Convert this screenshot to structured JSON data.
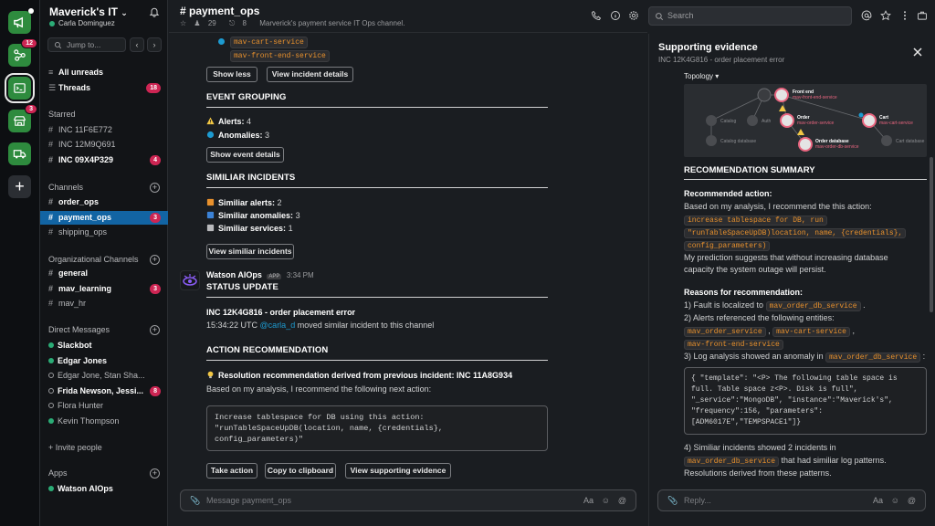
{
  "rail": {
    "apps": [
      {
        "name": "alerts-app",
        "badge": ""
      },
      {
        "name": "topology-app",
        "badge": "12"
      },
      {
        "name": "terminal-app",
        "badge": ""
      },
      {
        "name": "store-app",
        "badge": "3"
      },
      {
        "name": "delivery-app",
        "badge": ""
      }
    ],
    "add_label": "+"
  },
  "sidebar": {
    "workspace": "Maverick's IT",
    "user": "Carla Dominguez",
    "jump_placeholder": "Jump to...",
    "all_unreads": "All unreads",
    "threads": "Threads",
    "threads_badge": "18",
    "starred_label": "Starred",
    "starred": [
      {
        "label": "INC 11F6E772",
        "badge": "",
        "bold": false
      },
      {
        "label": "INC 12M9Q691",
        "badge": "",
        "bold": false
      },
      {
        "label": "INC 09X4P329",
        "badge": "4",
        "bold": true
      }
    ],
    "channels_label": "Channels",
    "channels": [
      {
        "label": "order_ops",
        "badge": "",
        "bold": true,
        "selected": false
      },
      {
        "label": "payment_ops",
        "badge": "3",
        "bold": true,
        "selected": true
      },
      {
        "label": "shipping_ops",
        "badge": "",
        "bold": false,
        "selected": false
      }
    ],
    "org_label": "Organizational Channels",
    "org_channels": [
      {
        "label": "general",
        "badge": "",
        "bold": true
      },
      {
        "label": "mav_learning",
        "badge": "3",
        "bold": true
      },
      {
        "label": "mav_hr",
        "badge": "",
        "bold": false
      }
    ],
    "dm_label": "Direct Messages",
    "dms": [
      {
        "label": "Slackbot",
        "online": true,
        "bold": true,
        "badge": ""
      },
      {
        "label": "Edgar Jones",
        "online": true,
        "bold": true,
        "badge": ""
      },
      {
        "label": "Edgar Jone, Stan Sha...",
        "online": false,
        "bold": false,
        "badge": ""
      },
      {
        "label": "Frida Newson, Jessi...",
        "online": false,
        "bold": true,
        "badge": "8"
      },
      {
        "label": "Flora Hunter",
        "online": false,
        "bold": false,
        "badge": ""
      },
      {
        "label": "Kevin Thompson",
        "online": true,
        "bold": false,
        "badge": ""
      }
    ],
    "invite": "+ Invite people",
    "apps_label": "Apps",
    "apps": [
      {
        "label": "Watson AIOps",
        "online": true
      }
    ]
  },
  "channel": {
    "title": "# payment_ops",
    "members": "29",
    "pins": "8",
    "topic": "Marverick's payment service IT Ops channel."
  },
  "search": {
    "placeholder": "Search"
  },
  "main": {
    "services": [
      "mav-cart-service",
      "mav-front-end-service"
    ],
    "show_less": "Show less",
    "view_incident": "View incident details",
    "event_grouping_title": "EVENT GROUPING",
    "alerts_label": "Alerts:",
    "alerts_count": "4",
    "anomalies_label": "Anomalies:",
    "anomalies_count": "3",
    "show_event": "Show event details",
    "similar_title": "SIMILIAR INCIDENTS",
    "similar_alerts_label": "Similiar alerts:",
    "similar_alerts_count": "2",
    "similar_anomalies_label": "Similiar anomalies:",
    "similar_anomalies_count": "3",
    "similar_services_label": "Similiar services:",
    "similar_services_count": "1",
    "view_similar": "View similiar incidents",
    "bot_name": "Watson AIOps",
    "bot_tag": "APP",
    "bot_time": "3:34 PM",
    "status_title": "STATUS UPDATE",
    "incident_line": "INC 12K4G816 - order placement error",
    "moved_time": "15:34:22 UTC",
    "moved_user": "@carla_d",
    "moved_text": "moved similar incident to this channel",
    "action_title": "ACTION RECOMMENDATION",
    "resolution_line": "Resolution recommendation derived from previous incident:  INC 11A8G934",
    "analysis_line": "Based on my analysis, I recommend the following next action:",
    "code": [
      "Increase tablespace for DB using this action:",
      "\"runTableSpaceUpDB(location, name, {credentials},",
      "config_parameters)\""
    ],
    "take_action": "Take action",
    "copy_clipboard": "Copy to clipboard",
    "view_evidence": "View supporting evidence",
    "composer_placeholder": "Message payment_ops"
  },
  "panel": {
    "title": "Supporting evidence",
    "subtitle": "INC 12K4G816 - order placement error",
    "topology_label": "Topology ▾",
    "topology_nodes": [
      {
        "title": "Front end",
        "service": "mav-front-end-service"
      },
      {
        "title": "Order",
        "service": "mav-order-service"
      },
      {
        "title": "Cart",
        "service": "mav-cart-service"
      },
      {
        "title": "Order database",
        "service": "mav-order-db-service"
      }
    ],
    "topology_muted": [
      "Catalog",
      "Auth",
      "Catalog database",
      "Cart database"
    ],
    "summary_title": "RECOMMENDATION SUMMARY",
    "rec_action_label": "Recommended action:",
    "rec_intro": "Based on my analysis, I recommend the this action:",
    "rec_code": [
      "increase tablespace for DB, run",
      "\"runTableSpaceUpDB)location, name, {credentials},",
      "config_parameters)"
    ],
    "prediction": [
      "My prediction suggests that without increasing database",
      "capacity the system outage will persist."
    ],
    "reasons_label": "Reasons for recommendation:",
    "reason1_pre": "1) Fault is localized to",
    "reason1_code": "mav_order_db_service",
    "reason1_post": ".",
    "reason2": "2) Alerts referenced the following entities:",
    "reason2_codes": [
      "mav_order_service",
      "mav-cart-service",
      "mav-front-end-service"
    ],
    "reason3_pre": "3) Log analysis showed an anomaly in",
    "reason3_code": "mav_order_db_service",
    "reason3_post": ":",
    "log_json": [
      "{ \"template\": \"<P> The following table space is",
      "full. Table space z<P>. Disk is full\",",
      "\"_service\":\"MongoDB\", \"instance\":\"Maverick's\",",
      "\"frequency\":156, \"parameters\":",
      "[ADM6017E\",\"TEMPSPACE1\"]}"
    ],
    "reason4_pre": "4)  Similiar incidents showed 2 incidents in",
    "reason4_code": "mav_order_db_service",
    "reason4_post": "that had similiar log patterns.",
    "reason4_tail": "Resolutions derived from these patterns.",
    "reply_placeholder": "Reply..."
  },
  "colors": {
    "accent": "#1264a3",
    "badge": "#cd2553",
    "code": "#e8912d",
    "link": "#1d9bd1",
    "online": "#2bac76",
    "app_tile": "#2e8b3e"
  }
}
